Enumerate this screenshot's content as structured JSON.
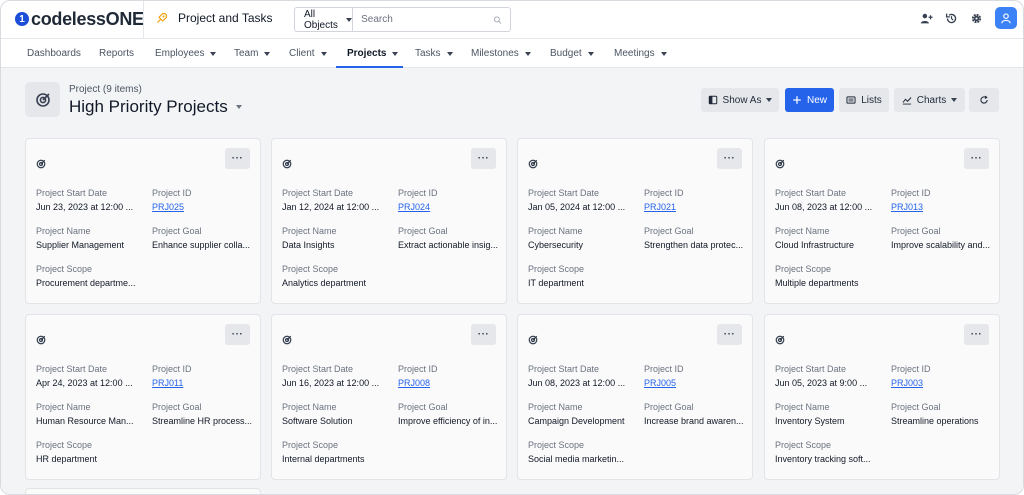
{
  "brand": {
    "logo_mark": "1",
    "logo_text": "codeless",
    "logo_text_bold": "ONE"
  },
  "app": {
    "title": "Project and Tasks",
    "icon": "rocket-icon"
  },
  "search": {
    "scope": "All Objects",
    "placeholder": "Search"
  },
  "top_actions": [
    "add-user-icon",
    "history-icon",
    "gear-icon",
    "user-avatar-icon"
  ],
  "nav": {
    "items": [
      {
        "label": "Dashboards",
        "dropdown": false
      },
      {
        "label": "Reports",
        "dropdown": false
      },
      {
        "label": "Employees",
        "dropdown": true
      },
      {
        "label": "Team",
        "dropdown": true
      },
      {
        "label": "Client",
        "dropdown": true
      },
      {
        "label": "Projects",
        "dropdown": true,
        "active": true
      },
      {
        "label": "Tasks",
        "dropdown": true
      },
      {
        "label": "Milestones",
        "dropdown": true
      },
      {
        "label": "Budget",
        "dropdown": true
      },
      {
        "label": "Meetings",
        "dropdown": true
      }
    ]
  },
  "header": {
    "subtitle": "Project (9 items)",
    "title": "High Priority Projects"
  },
  "toolbar": {
    "show_as": "Show As",
    "new": "New",
    "lists": "Lists",
    "charts": "Charts"
  },
  "field_labels": {
    "start_date": "Project Start Date",
    "id": "Project ID",
    "name": "Project Name",
    "goal": "Project Goal",
    "scope": "Project Scope"
  },
  "menu_label": "···",
  "cards": [
    {
      "start_date": "Jun 23, 2023 at 12:00 ...",
      "id": "PRJ025",
      "name": "Supplier Management",
      "goal": "Enhance supplier colla...",
      "scope": "Procurement departme..."
    },
    {
      "start_date": "Jan 12, 2024 at 12:00 ...",
      "id": "PRJ024",
      "name": "Data Insights",
      "goal": "Extract actionable insig...",
      "scope": "Analytics department"
    },
    {
      "start_date": "Jan 05, 2024 at 12:00 ...",
      "id": "PRJ021",
      "name": "Cybersecurity",
      "goal": "Strengthen data protec...",
      "scope": "IT department"
    },
    {
      "start_date": "Jun 08, 2023 at 12:00 ...",
      "id": "PRJ013",
      "name": "Cloud Infrastructure",
      "goal": "Improve scalability and...",
      "scope": "Multiple departments"
    },
    {
      "start_date": "Apr 24, 2023 at 12:00 ...",
      "id": "PRJ011",
      "name": "Human Resource Man...",
      "goal": "Streamline HR process...",
      "scope": "HR department"
    },
    {
      "start_date": "Jun 16, 2023 at 12:00 ...",
      "id": "PRJ008",
      "name": "Software Solution",
      "goal": "Improve efficiency of in...",
      "scope": "Internal departments"
    },
    {
      "start_date": "Jun 08, 2023 at 12:00 ...",
      "id": "PRJ005",
      "name": "Campaign Development",
      "goal": "Increase brand awaren...",
      "scope": "Social media marketin..."
    },
    {
      "start_date": "Jun 05, 2023 at 9:00 ...",
      "id": "PRJ003",
      "name": "Inventory System",
      "goal": "Streamline operations",
      "scope": "Inventory tracking soft..."
    }
  ],
  "colors": {
    "accent": "#2563eb",
    "background": "#f3f4f6",
    "card": "#fafafa"
  }
}
